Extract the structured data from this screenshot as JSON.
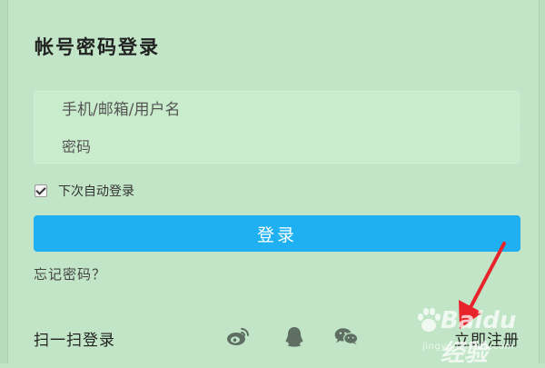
{
  "title": "帐号密码登录",
  "form": {
    "username_placeholder": "手机/邮箱/用户名",
    "username_value": "",
    "password_placeholder": "密码",
    "password_value": "",
    "remember_label": "下次自动登录",
    "remember_checked": true,
    "login_label": "登录",
    "forgot_label": "忘记密码？"
  },
  "footer": {
    "scan_label": "扫一扫登录",
    "social_icons": [
      "weibo-icon",
      "qq-icon",
      "wechat-icon"
    ],
    "register_label": "立即注册"
  },
  "watermark": {
    "brand": "Baidu 经验",
    "sub": "jingyan.baidu.com"
  },
  "colors": {
    "background": "#c1e5c6",
    "accent": "#1eb0f0",
    "arrow": "#e8232b"
  }
}
